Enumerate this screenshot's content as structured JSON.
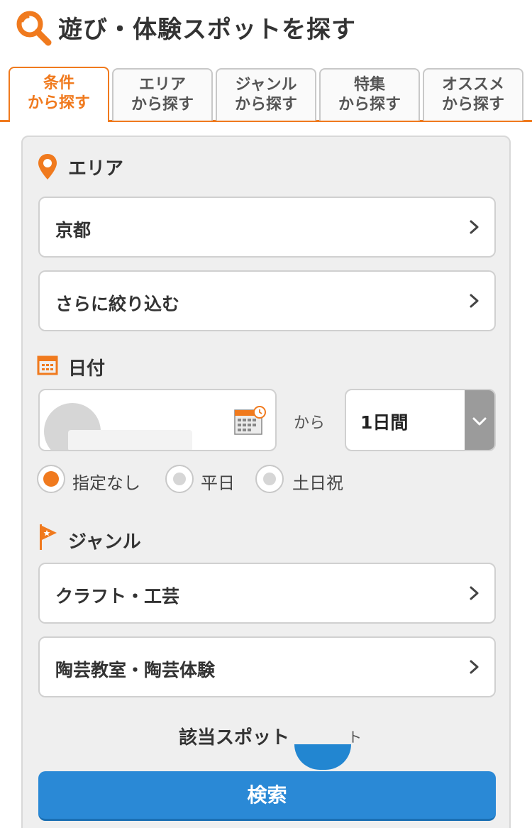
{
  "header": {
    "title": "遊び・体験スポットを探す",
    "icon": "magnifier-icon"
  },
  "tabs": [
    {
      "line1": "条件",
      "line2": "から探す",
      "active": true
    },
    {
      "line1": "エリア",
      "line2": "から探す",
      "active": false
    },
    {
      "line1": "ジャンル",
      "line2": "から探す",
      "active": false
    },
    {
      "line1": "特集",
      "line2": "から探す",
      "active": false
    },
    {
      "line1": "オススメ",
      "line2": "から探す",
      "active": false
    }
  ],
  "area": {
    "label": "エリア",
    "prefecture": "京都",
    "refine": "さらに絞り込む"
  },
  "date": {
    "label": "日付",
    "from_text": "から",
    "duration": "1日間",
    "radios": [
      {
        "label": "指定なし",
        "checked": true
      },
      {
        "label": "平日",
        "checked": false
      },
      {
        "label": "土日祝",
        "checked": false
      }
    ]
  },
  "genre": {
    "label": "ジャンル",
    "category": "クラフト・工芸",
    "subcategory": "陶芸教室・陶芸体験"
  },
  "results": {
    "count_label": "該当スポット",
    "tail": "ト"
  },
  "search_button": "検索",
  "colors": {
    "accent": "#f07a1e",
    "button": "#2a89d6"
  }
}
